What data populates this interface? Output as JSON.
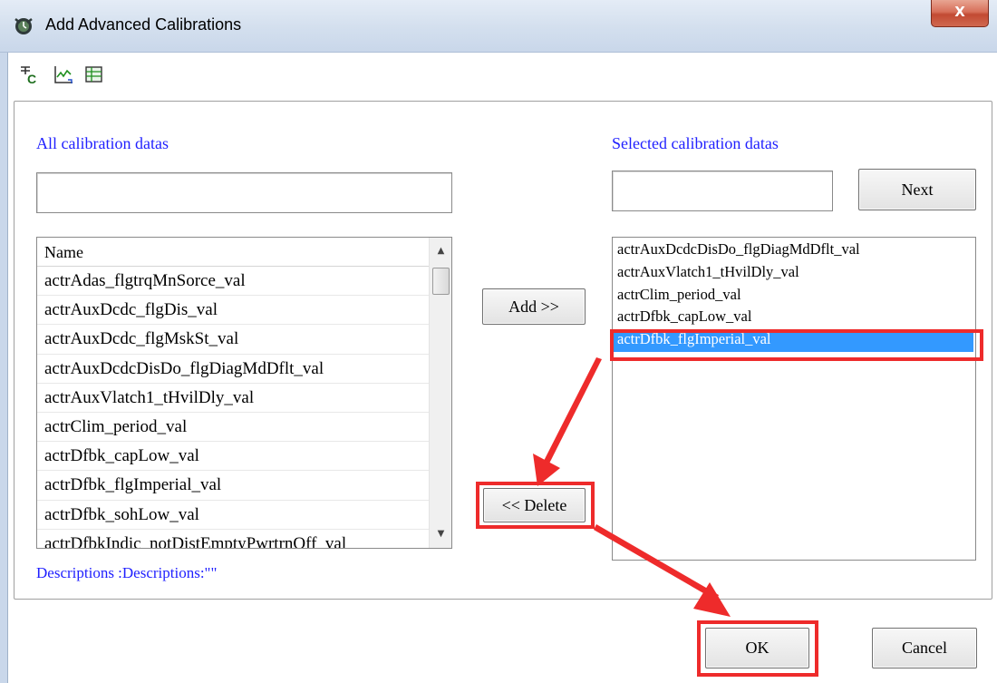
{
  "window": {
    "title": "Add Advanced Calibrations",
    "close_glyph": "X"
  },
  "toolbar": {
    "icons": [
      "calibration-c-icon",
      "trend-chart-icon",
      "grid-table-icon"
    ]
  },
  "left_panel": {
    "label": "All calibration datas",
    "search_value": "",
    "column_header": "Name",
    "items": [
      "actrAdas_flgtrqMnSorce_val",
      "actrAuxDcdc_flgDis_val",
      "actrAuxDcdc_flgMskSt_val",
      "actrAuxDcdcDisDo_flgDiagMdDflt_val",
      "actrAuxVlatch1_tHvilDly_val",
      "actrClim_period_val",
      "actrDfbk_capLow_val",
      "actrDfbk_flgImperial_val",
      "actrDfbk_sohLow_val",
      "actrDfbkIndic_notDistEmptyPwrtrnOff_val"
    ]
  },
  "middle": {
    "add_label": "Add >>",
    "delete_label": "<< Delete"
  },
  "right_panel": {
    "label": "Selected calibration datas",
    "search_value": "",
    "next_label": "Next",
    "items": [
      "actrAuxDcdcDisDo_flgDiagMdDflt_val",
      "actrAuxVlatch1_tHvilDly_val",
      "actrClim_period_val",
      "actrDfbk_capLow_val",
      "actrDfbk_flgImperial_val"
    ],
    "selected_index": 4
  },
  "description": "Descriptions :Descriptions:\"\"",
  "footer": {
    "ok_label": "OK",
    "cancel_label": "Cancel"
  },
  "colors": {
    "label_blue": "#1f1fff",
    "selection": "#3399ff",
    "annotation_red": "#ee2b2b"
  }
}
